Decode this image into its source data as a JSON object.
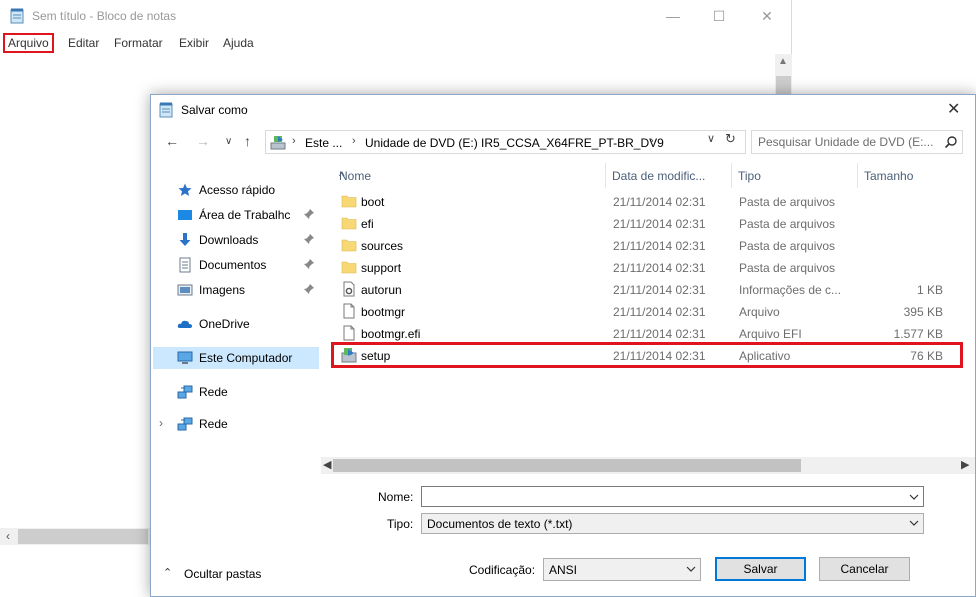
{
  "notepad": {
    "title": "Sem título - Bloco de notas",
    "menu": [
      "Arquivo",
      "Editar",
      "Formatar",
      "Exibir",
      "Ajuda"
    ],
    "window_buttons": {
      "minimize": "—",
      "maximize": "☐",
      "close": "✕"
    }
  },
  "dialog": {
    "title": "Salvar como",
    "close": "✕",
    "address": {
      "segments": [
        "Este ...",
        "Unidade de DVD (E:) IR5_CCSA_X64FRE_PT-BR_DV9"
      ]
    },
    "search": {
      "placeholder": "Pesquisar Unidade de DVD (E:..."
    },
    "nav": [
      {
        "label": "Acesso rápido",
        "icon": "star-icon",
        "pinned": false
      },
      {
        "label": "Área de Trabalhc",
        "icon": "desktop-icon",
        "pinned": true
      },
      {
        "label": "Downloads",
        "icon": "download-icon",
        "pinned": true
      },
      {
        "label": "Documentos",
        "icon": "documents-icon",
        "pinned": true
      },
      {
        "label": "Imagens",
        "icon": "images-icon",
        "pinned": true
      },
      {
        "label": "OneDrive",
        "icon": "cloud-icon",
        "pinned": false
      },
      {
        "label": "Este Computador",
        "icon": "computer-icon",
        "pinned": false,
        "selected": true
      },
      {
        "label": "Rede",
        "icon": "network-icon",
        "pinned": false
      },
      {
        "label": "Rede",
        "icon": "network-icon",
        "pinned": false,
        "expandable": true
      }
    ],
    "columns": [
      "Nome",
      "Data de modific...",
      "Tipo",
      "Tamanho"
    ],
    "files": [
      {
        "name": "boot",
        "date": "21/11/2014 02:31",
        "type": "Pasta de arquivos",
        "size": "",
        "icon": "folder-icon"
      },
      {
        "name": "efi",
        "date": "21/11/2014 02:31",
        "type": "Pasta de arquivos",
        "size": "",
        "icon": "folder-icon"
      },
      {
        "name": "sources",
        "date": "21/11/2014 02:31",
        "type": "Pasta de arquivos",
        "size": "",
        "icon": "folder-icon"
      },
      {
        "name": "support",
        "date": "21/11/2014 02:31",
        "type": "Pasta de arquivos",
        "size": "",
        "icon": "folder-icon"
      },
      {
        "name": "autorun",
        "date": "21/11/2014 02:31",
        "type": "Informações de c...",
        "size": "1 KB",
        "icon": "settings-file-icon"
      },
      {
        "name": "bootmgr",
        "date": "21/11/2014 02:31",
        "type": "Arquivo",
        "size": "395 KB",
        "icon": "file-icon"
      },
      {
        "name": "bootmgr.efi",
        "date": "21/11/2014 02:31",
        "type": "Arquivo EFI",
        "size": "1.577 KB",
        "icon": "file-icon"
      },
      {
        "name": "setup",
        "date": "21/11/2014 02:31",
        "type": "Aplicativo",
        "size": "76 KB",
        "icon": "setup-app-icon",
        "highlighted": true
      }
    ],
    "form": {
      "name_label": "Nome:",
      "name_value": "",
      "type_label": "Tipo:",
      "type_value": "Documentos de texto (*.txt)",
      "encoding_label": "Codificação:",
      "encoding_value": "ANSI",
      "save_label": "Salvar",
      "cancel_label": "Cancelar",
      "hide_folders_label": "Ocultar pastas"
    }
  },
  "colors": {
    "highlight": "#e0141e",
    "selection": "#cce8ff",
    "folder": "#f8d775",
    "accent": "#0078d7"
  }
}
